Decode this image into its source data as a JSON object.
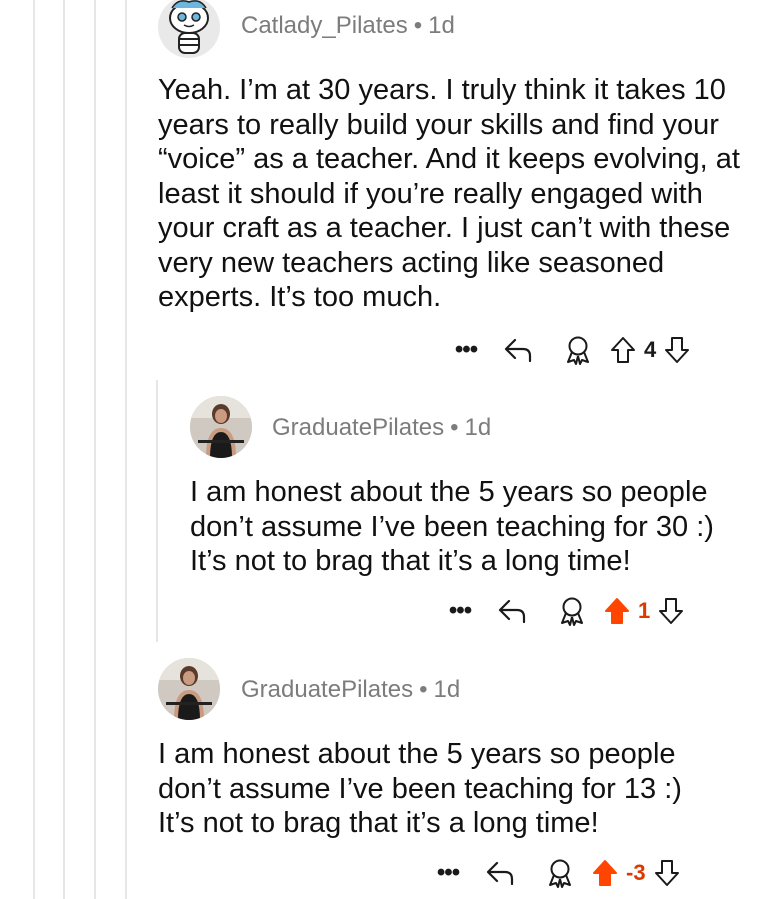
{
  "comments": [
    {
      "author": "Catlady_Pilates",
      "age": "1d",
      "separator": "•",
      "avatar_icon": "snoo-avatar-icon",
      "text": "Yeah.  I’m at 30 years.  I truly think it takes 10 years to really build your skills and find your “voice” as a teacher.  And it keeps evolving,  at least it should if you’re really engaged with your craft as a teacher.  I just can’t with these very new teachers acting like seasoned experts.  It’s too much.",
      "more_label": "•••",
      "score": "4",
      "upvoted": false
    },
    {
      "author": "GraduatePilates",
      "age": "1d",
      "separator": "•",
      "avatar_icon": "user-photo-avatar",
      "text": "I am honest about the 5 years so people don’t assume I’ve been teaching for 30 :) It’s not to brag that it’s a long time!",
      "more_label": "•••",
      "score": "1",
      "upvoted": true
    },
    {
      "author": "GraduatePilates",
      "age": "1d",
      "separator": "•",
      "avatar_icon": "user-photo-avatar",
      "text": "I am honest about the 5 years so people don’t assume I’ve been teaching for 13 :) It’s not to brag that it’s a long time!",
      "more_label": "•••",
      "score": "-3",
      "upvoted": true
    }
  ],
  "colors": {
    "upvote_active": "#ff4500",
    "score_active": "#d93a00",
    "meta_text": "#7c7c7c",
    "thread_line": "#e4e6e8"
  }
}
